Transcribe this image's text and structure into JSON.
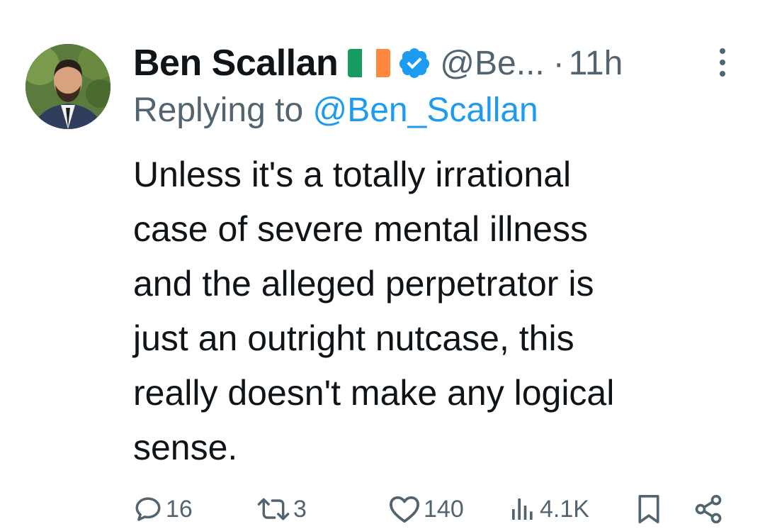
{
  "author": {
    "name": "Ben Scallan",
    "handle": "@Be...",
    "separator": "·",
    "time": "11h",
    "flag_colors": [
      "#169b62",
      "#ffffff",
      "#ff883e"
    ],
    "verified_color": "#1d9bf0"
  },
  "reply": {
    "prefix": "Replying to",
    "mention": "@Ben_Scallan"
  },
  "body": {
    "lines": [
      "Unless it's a totally irrational",
      "case of severe mental illness",
      "and the alleged perpetrator is",
      "just an outright nutcase, this",
      "really doesn't make any logical",
      "sense."
    ]
  },
  "actions": {
    "replies": "16",
    "retweets": "3",
    "likes": "140",
    "views": "4.1K"
  },
  "colors": {
    "text": "#0f1419",
    "secondary": "#536471",
    "accent": "#1d9bf0"
  }
}
